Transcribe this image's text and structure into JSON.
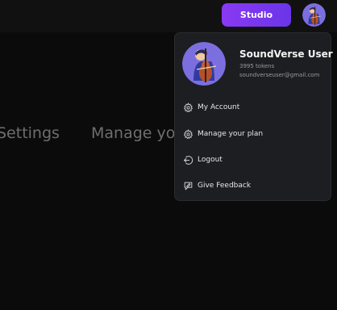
{
  "header": {
    "studio_label": "Studio",
    "avatar_icon": "cello-avatar-icon"
  },
  "background": {
    "settings_text": "Settings",
    "manage_text": "Manage you"
  },
  "account_menu": {
    "user_name": "SoundVerse User",
    "tokens": "3995 tokens",
    "email": "soundverseuser@gmail.com",
    "items": [
      {
        "label": "My Account",
        "icon": "gear-icon"
      },
      {
        "label": "Manage your plan",
        "icon": "gear-icon"
      },
      {
        "label": "Logout",
        "icon": "logout-icon"
      },
      {
        "label": "Give Feedback",
        "icon": "feedback-icon"
      }
    ]
  },
  "colors": {
    "accent": "#8a39f3",
    "menu_bg": "#1d1e21",
    "page_bg": "#0b0b0b"
  }
}
